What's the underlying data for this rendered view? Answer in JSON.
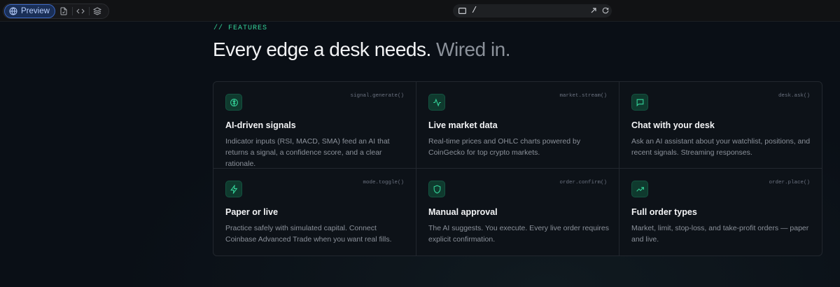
{
  "toolbar": {
    "preview_label": "Preview",
    "icons": [
      "globe-icon",
      "file-icon",
      "code-icon",
      "layers-icon"
    ]
  },
  "url": {
    "path": "/"
  },
  "section": {
    "eyebrow": "// FEATURES",
    "headline_main": "Every edge a desk needs.",
    "headline_muted": " Wired in."
  },
  "features": [
    {
      "icon": "brain-icon",
      "code": "signal.generate()",
      "title": "AI-driven signals",
      "desc": "Indicator inputs (RSI, MACD, SMA) feed an AI that returns a signal, a confidence score, and a clear rationale."
    },
    {
      "icon": "activity-icon",
      "code": "market.stream()",
      "title": "Live market data",
      "desc": "Real-time prices and OHLC charts powered by CoinGecko for top crypto markets."
    },
    {
      "icon": "chat-icon",
      "code": "desk.ask()",
      "title": "Chat with your desk",
      "desc": "Ask an AI assistant about your watchlist, positions, and recent signals. Streaming responses."
    },
    {
      "icon": "bolt-icon",
      "code": "mode.toggle()",
      "title": "Paper or live",
      "desc": "Practice safely with simulated capital. Connect Coinbase Advanced Trade when you want real fills."
    },
    {
      "icon": "shield-icon",
      "code": "order.confirm()",
      "title": "Manual approval",
      "desc": "The AI suggests. You execute. Every live order requires explicit confirmation."
    },
    {
      "icon": "trend-up-icon",
      "code": "order.place()",
      "title": "Full order types",
      "desc": "Market, limit, stop-loss, and take-profit orders — paper and live."
    }
  ],
  "colors": {
    "accent": "#34d399",
    "background": "#0a0f16",
    "preview_button": "#1a2f57"
  }
}
